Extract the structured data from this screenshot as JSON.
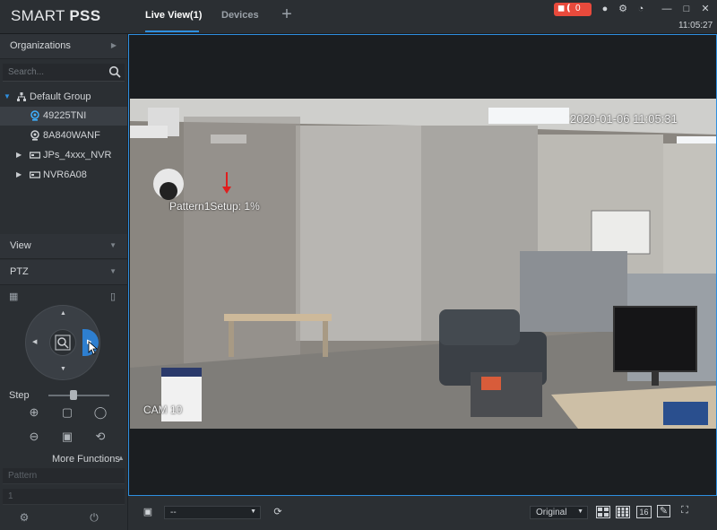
{
  "app": {
    "logo_light": "SMART ",
    "logo_bold": "PSS",
    "clock": "11:05:27",
    "alarm_count": "0"
  },
  "tabs": [
    {
      "label": "Live View(1)",
      "active": true
    },
    {
      "label": "Devices",
      "active": false
    }
  ],
  "sidebar": {
    "organizations_label": "Organizations",
    "search_placeholder": "Search...",
    "tree": [
      {
        "label": "Default Group",
        "icon": "org-tree-icon",
        "expanded": true
      },
      {
        "label": "49225TNI",
        "icon": "camera-icon",
        "selected": true
      },
      {
        "label": "8A840WANF",
        "icon": "camera-icon"
      },
      {
        "label": "JPs_4xxx_NVR",
        "icon": "nvr-icon",
        "expanded": false
      },
      {
        "label": "NVR6A08",
        "icon": "nvr-icon",
        "expanded": false
      }
    ],
    "view_label": "View",
    "ptz_label": "PTZ",
    "step_label": "Step",
    "step_value": 0.42,
    "more_functions_label": "More Functions",
    "pattern_placeholder": "Pattern",
    "pattern_number": "1"
  },
  "video": {
    "timestamp": "2020-01-06 11:05:31",
    "status_text": "Pattern1Setup: 1%",
    "camera_label": "CAM 10"
  },
  "footer": {
    "preset_dropdown": "--",
    "stream_mode": "Original",
    "layout_16_label": "16"
  },
  "colors": {
    "accent": "#2e8fe0",
    "alarm": "#e84a3c"
  }
}
